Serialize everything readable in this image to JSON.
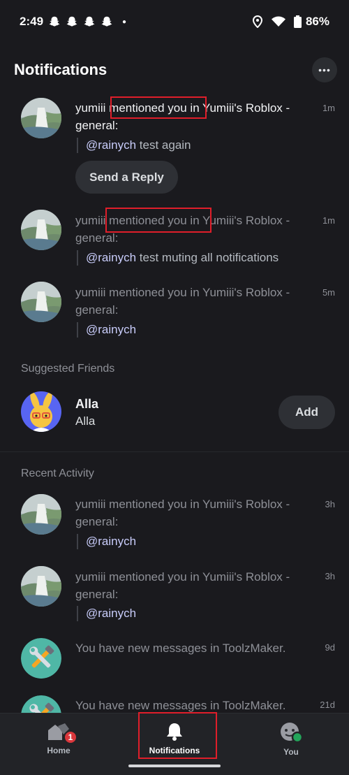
{
  "status_bar": {
    "time": "2:49",
    "battery": "86%"
  },
  "header": {
    "title": "Notifications",
    "more_label": "•••"
  },
  "notifications": [
    {
      "text": "yumiii mentioned you in Yumiii's Roblox - general:",
      "time": "1m",
      "mention": "@rainych",
      "quote": " test again",
      "reply_label": "Send a Reply",
      "unread": true
    },
    {
      "text": "yumiii mentioned you in Yumiii's Roblox - general:",
      "time": "1m",
      "mention": "@rainych",
      "quote": " test muting all notifications"
    },
    {
      "text": "yumiii mentioned you in Yumiii's Roblox - general:",
      "time": "5m",
      "mention": "@rainych",
      "quote": ""
    }
  ],
  "suggested": {
    "label": "Suggested Friends",
    "friend": {
      "name": "Alla",
      "username": "Alla",
      "add_label": "Add"
    }
  },
  "recent": {
    "label": "Recent Activity",
    "items": [
      {
        "text": "yumiii mentioned you in Yumiii's Roblox - general:",
        "time": "3h",
        "mention": "@rainych"
      },
      {
        "text": "yumiii mentioned you in Yumiii's Roblox - general:",
        "time": "3h",
        "mention": "@rainych"
      },
      {
        "text": "You have new messages in ToolzMaker.",
        "time": "9d"
      },
      {
        "text": "You have new messages in ToolzMaker.",
        "time": "21d"
      }
    ]
  },
  "nav": {
    "home": "Home",
    "home_badge": "1",
    "notifications": "Notifications",
    "you": "You"
  },
  "colors": {
    "highlight": "#e01e2a",
    "online": "#23a55a",
    "badge": "#da373c"
  }
}
